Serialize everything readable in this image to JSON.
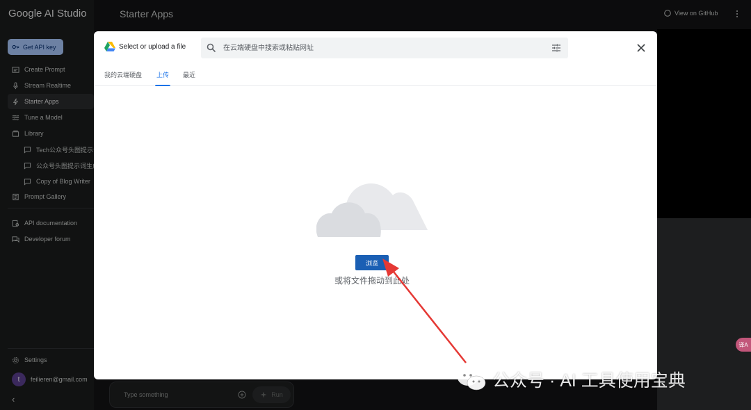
{
  "app": {
    "brand": "Google AI Studio",
    "page_title": "Starter Apps",
    "github_label": "View on GitHub"
  },
  "sidebar": {
    "api_key_label": "Get API key",
    "items": [
      {
        "label": "Create Prompt",
        "icon": "create-prompt-icon"
      },
      {
        "label": "Stream Realtime",
        "icon": "mic-icon"
      },
      {
        "label": "Starter Apps",
        "icon": "bolt-icon",
        "active": true
      },
      {
        "label": "Tune a Model",
        "icon": "tune-icon"
      },
      {
        "label": "Library",
        "icon": "library-icon"
      }
    ],
    "library_items": [
      {
        "label": "Tech公众号头图提示词"
      },
      {
        "label": "公众号头图提示词生成"
      },
      {
        "label": "Copy of Blog Writer"
      }
    ],
    "gallery_label": "Prompt Gallery",
    "api_docs_label": "API documentation",
    "forum_label": "Developer forum",
    "settings_label": "Settings",
    "user_initial": "t",
    "user_email": "feilieren@gmail.com",
    "collapse_glyph": "‹"
  },
  "prompt": {
    "placeholder": "Type something",
    "run_label": "Run"
  },
  "dialog": {
    "title": "Select or upload a file",
    "search_placeholder": "在云端硬盘中搜索或粘贴网址",
    "tabs": [
      {
        "label": "我的云端硬盘"
      },
      {
        "label": "上传",
        "active": true
      },
      {
        "label": "最近"
      }
    ],
    "browse_label": "浏览",
    "drop_hint": "或将文件拖动到此处"
  },
  "overlay": {
    "translate_chip": "译A",
    "watermark": "公众号 · AI 工具使用宝典"
  },
  "colors": {
    "accent": "#1a73e8",
    "browse_button": "#1a5fb4",
    "api_button": "#a8c7fa",
    "annotation_arrow": "#e53935"
  }
}
